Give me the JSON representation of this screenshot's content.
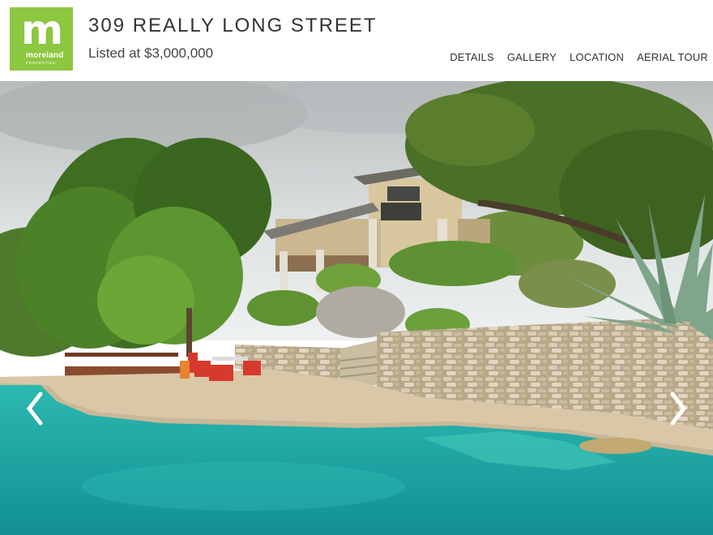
{
  "logo": {
    "letter": "m",
    "brand": "moreland",
    "tagline": "PROPERTIES",
    "color": "#8dc63f"
  },
  "listing": {
    "address": "309 REALLY LONG STREET",
    "price": "Listed at $3,000,000"
  },
  "nav": {
    "items": [
      "DETAILS",
      "GALLERY",
      "LOCATION",
      "AERIAL TOUR"
    ]
  },
  "slideshow": {
    "prev_icon": "chevron-left-icon",
    "next_icon": "chevron-right-icon"
  }
}
